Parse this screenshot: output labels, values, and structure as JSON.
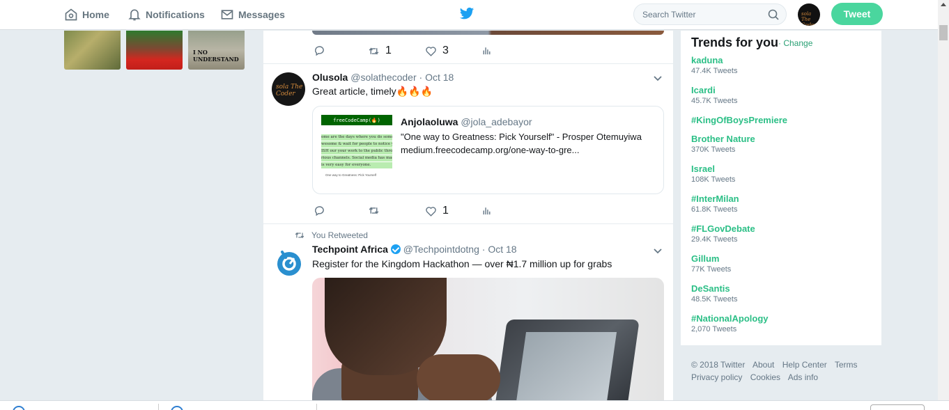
{
  "nav": {
    "home_label": "Home",
    "notifications_label": "Notifications",
    "messages_label": "Messages",
    "search_placeholder": "Search Twitter",
    "tweet_button_label": "Tweet",
    "avatar_text": "sola The Coder"
  },
  "left_photos": {
    "photo3_caption": "I NO UNDERSTAND"
  },
  "timeline": {
    "tweet0": {
      "retweets": "1",
      "likes": "3"
    },
    "tweet1": {
      "name": "Olusola",
      "handle": "@solathecoder",
      "date": "· Oct 18",
      "text": "Great article, timely🔥🔥🔥",
      "avatar_text": "sola The Coder",
      "card": {
        "image_header": "freeCodeCamp(🔥)",
        "image_lines": [
          "ome are the days where you do somethin",
          "wesome & wait for people to notice you.",
          "ISH our your work to the public throug",
          "rious channels. Social media has made",
          "is very easy for everyone."
        ],
        "image_footer": "One way to Greatness: Pick Yourself",
        "author_name": "Anjolaoluwa",
        "author_handle": "@jola_adebayor",
        "description": "\"One way to Greatness: Pick Yourself\" - Prosper Otemuyiwa",
        "link": "medium.freecodecamp.org/one-way-to-gre..."
      },
      "retweets": "",
      "likes": "1"
    },
    "tweet2": {
      "retweet_label": "You Retweeted",
      "name": "Techpoint Africa",
      "handle": "@Techpointdotng",
      "date": "· Oct 18",
      "text": "Register for the Kingdom Hackathon — over ₦1.7 million up for grabs"
    }
  },
  "trends": {
    "title": "Trends for you",
    "change_label": "· Change",
    "items": [
      {
        "name": "kaduna",
        "count": "47.4K Tweets"
      },
      {
        "name": "Icardi",
        "count": "45.7K Tweets"
      },
      {
        "name": "#KingOfBoysPremiere",
        "count": ""
      },
      {
        "name": "Brother Nature",
        "count": "370K Tweets"
      },
      {
        "name": "Israel",
        "count": "108K Tweets"
      },
      {
        "name": "#InterMilan",
        "count": "61.8K Tweets"
      },
      {
        "name": "#FLGovDebate",
        "count": "29.4K Tweets"
      },
      {
        "name": "Gillum",
        "count": "77K Tweets"
      },
      {
        "name": "DeSantis",
        "count": "48.5K Tweets"
      },
      {
        "name": "#NationalApology",
        "count": "2,070 Tweets"
      }
    ]
  },
  "footer": {
    "copyright": "© 2018 Twitter",
    "about": "About",
    "help_center": "Help Center",
    "terms": "Terms",
    "privacy": "Privacy policy",
    "cookies": "Cookies",
    "ads_info": "Ads info"
  },
  "colors": {
    "accent_green": "#2bbf86",
    "tweet_button": "#4ad69e",
    "twitter_blue": "#1da1f2"
  }
}
